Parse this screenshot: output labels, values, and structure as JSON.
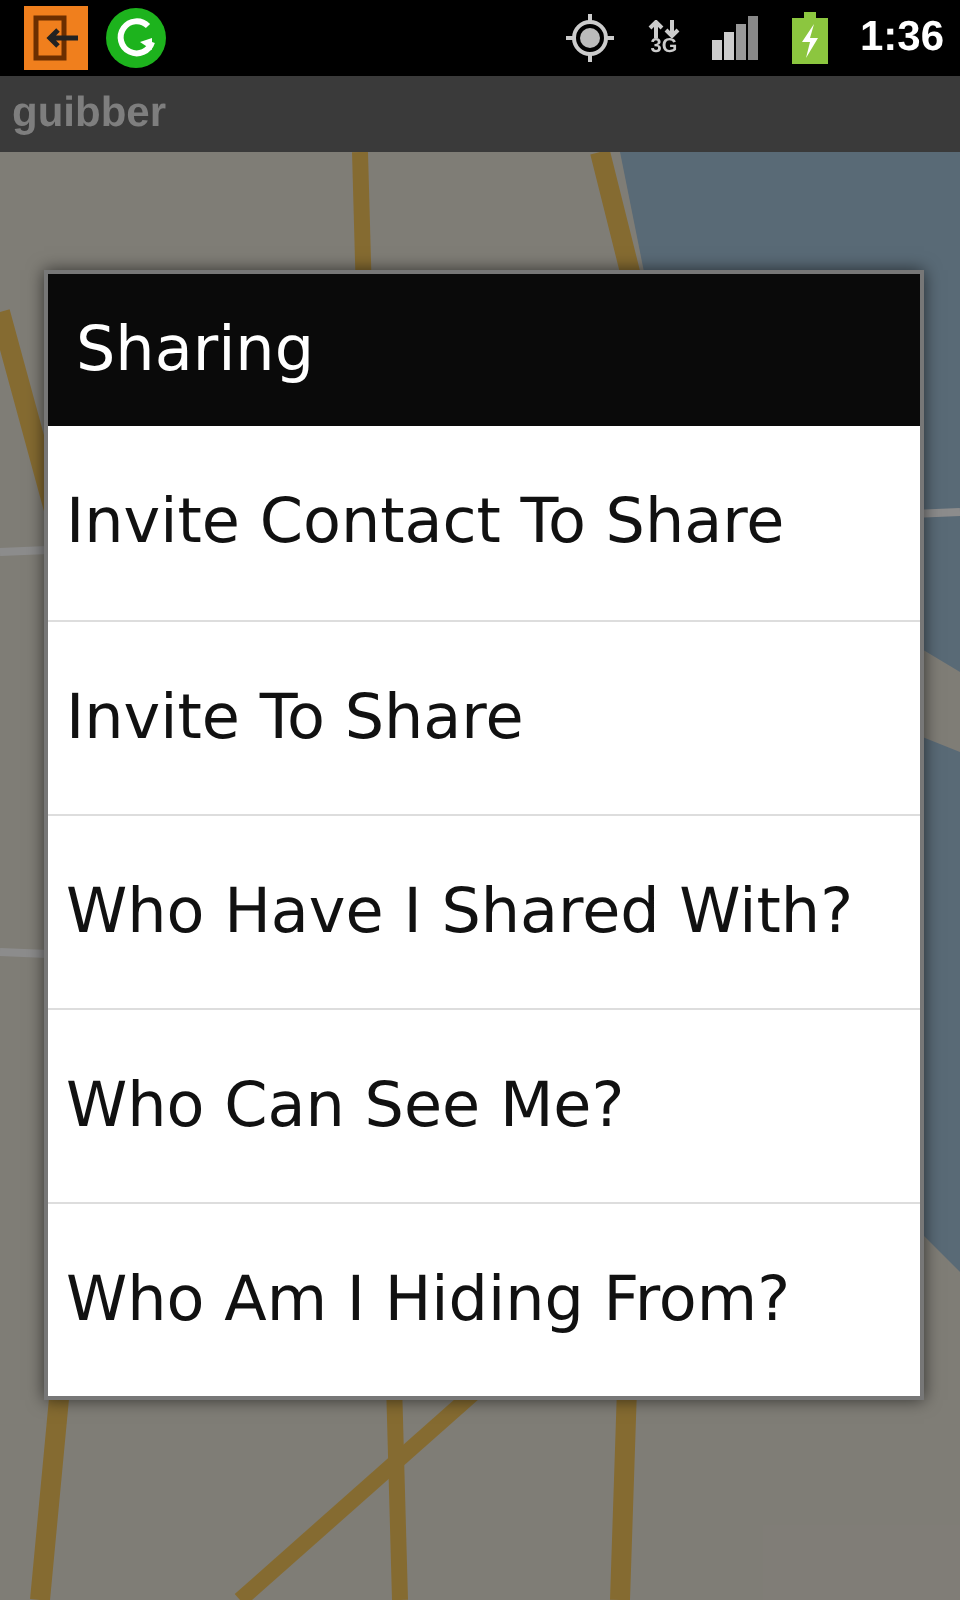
{
  "status_bar": {
    "network": "3G",
    "time": "1:36"
  },
  "app_title": "guibber",
  "dialog": {
    "title": "Sharing",
    "items": [
      {
        "label": "Invite Contact To Share"
      },
      {
        "label": "Invite To Share"
      },
      {
        "label": "Who Have I Shared With?"
      },
      {
        "label": "Who Can See Me?"
      },
      {
        "label": "Who Am I Hiding From?"
      }
    ]
  }
}
